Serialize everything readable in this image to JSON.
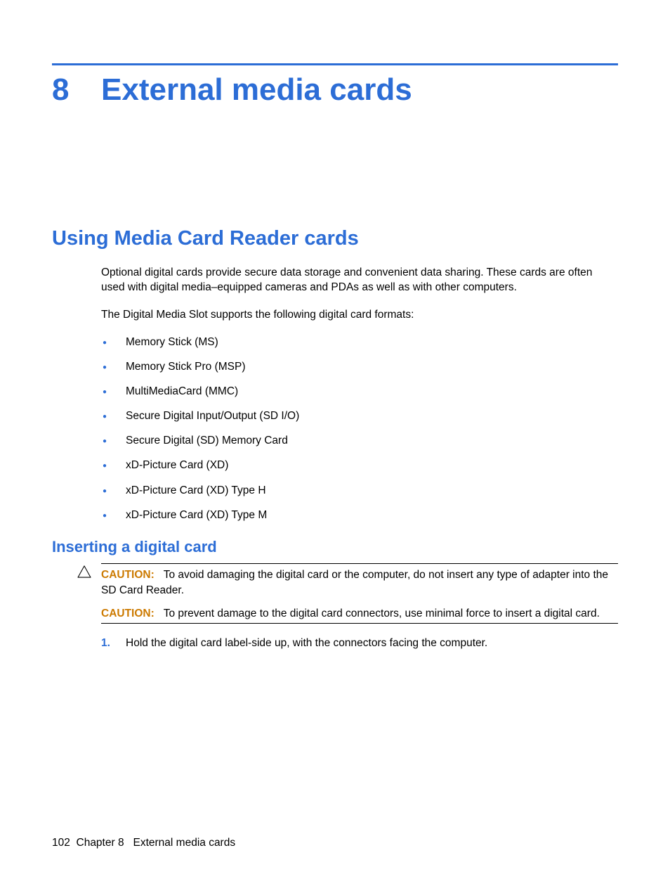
{
  "chapter": {
    "number": "8",
    "title": "External media cards"
  },
  "section": {
    "heading": "Using Media Card Reader cards",
    "para1": "Optional digital cards provide secure data storage and convenient data sharing. These cards are often used with digital media–equipped cameras and PDAs as well as with other computers.",
    "para2": "The Digital Media Slot supports the following digital card formats:",
    "bullets": [
      "Memory Stick (MS)",
      "Memory Stick Pro (MSP)",
      "MultiMediaCard (MMC)",
      "Secure Digital Input/Output (SD I/O)",
      "Secure Digital (SD) Memory Card",
      "xD-Picture Card (XD)",
      "xD-Picture Card (XD) Type H",
      "xD-Picture Card (XD) Type M"
    ]
  },
  "subsection": {
    "heading": "Inserting a digital card",
    "caution": {
      "label": "CAUTION:",
      "text1": "To avoid damaging the digital card or the computer, do not insert any type of adapter into the SD Card Reader.",
      "text2": "To prevent damage to the digital card connectors, use minimal force to insert a digital card."
    },
    "steps": [
      {
        "num": "1.",
        "text": "Hold the digital card label-side up, with the connectors facing the computer."
      }
    ]
  },
  "footer": {
    "page": "102",
    "chapter_label": "Chapter 8",
    "chapter_name": "External media cards"
  }
}
